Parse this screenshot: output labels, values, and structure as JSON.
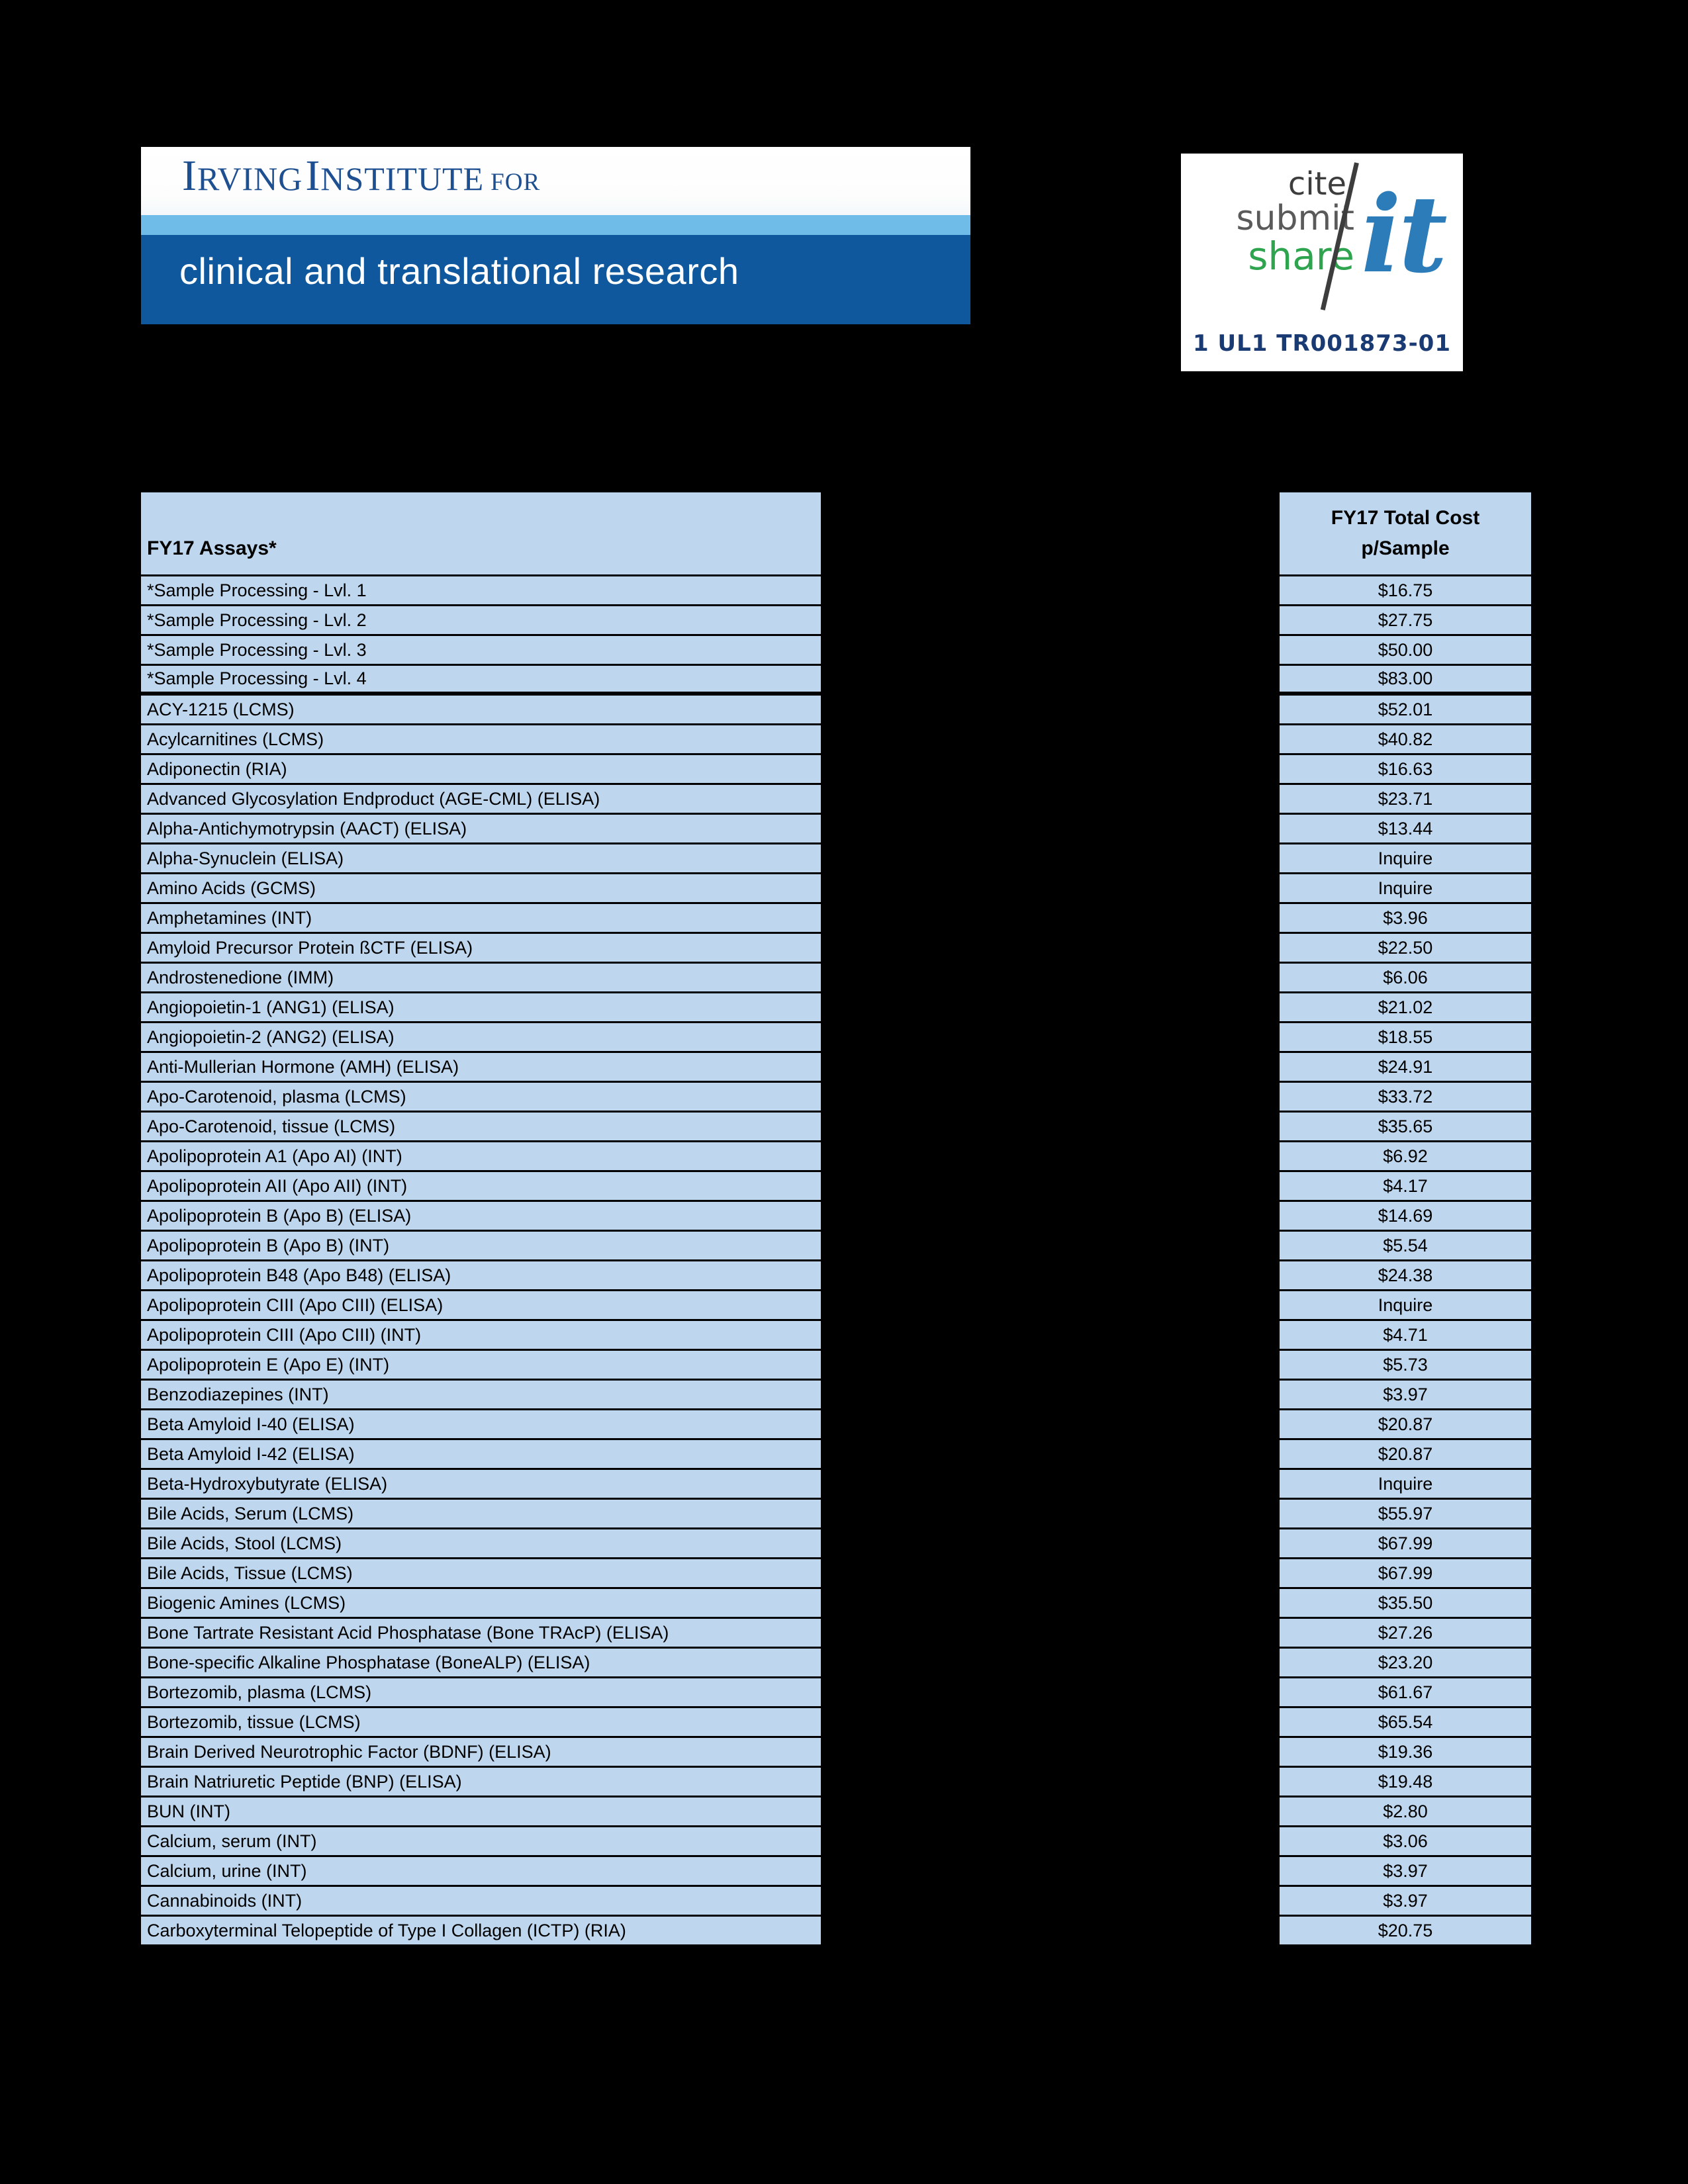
{
  "header": {
    "irving_logo": {
      "line1_word1": "I",
      "line1_word1_rest": "RVING",
      "line1_word2": "I",
      "line1_word2_rest": "NSTITUTE",
      "line1_for": "FOR",
      "line2": "clinical and translational research",
      "colors": {
        "title_blue": "#1d4f91",
        "band_light": "#6fbce8",
        "band_dark": "#10589e"
      }
    },
    "cite_logo": {
      "word_cite": "cite",
      "word_submit": "submit",
      "word_share": "share",
      "word_it": "it",
      "grant_number": "1 UL1 TR001873-01",
      "colors": {
        "cite": "#3d3d3d",
        "submit": "#5a5a5a",
        "share": "#2ea44f",
        "it": "#2b7cb8",
        "grant": "#1a3a73"
      }
    }
  },
  "table": {
    "columns": {
      "assay": "FY17 Assays*",
      "cost_line1": "FY17 Total Cost",
      "cost_line2": "p/Sample"
    },
    "colors": {
      "cell_fill": "#bed7ee",
      "grid": "#000000",
      "page_background": "#000000"
    },
    "rows": [
      {
        "assay": "*Sample Processing - Lvl. 1",
        "cost": "$16.75"
      },
      {
        "assay": "*Sample Processing - Lvl. 2",
        "cost": "$27.75"
      },
      {
        "assay": "*Sample Processing - Lvl. 3",
        "cost": "$50.00"
      },
      {
        "assay": "*Sample Processing - Lvl. 4",
        "cost": "$83.00"
      },
      {
        "assay": "ACY-1215 (LCMS)",
        "cost": "$52.01"
      },
      {
        "assay": "Acylcarnitines (LCMS)",
        "cost": "$40.82"
      },
      {
        "assay": "Adiponectin (RIA)",
        "cost": "$16.63"
      },
      {
        "assay": "Advanced Glycosylation Endproduct  (AGE-CML) (ELISA)",
        "cost": "$23.71"
      },
      {
        "assay": "Alpha-Antichymotrypsin (AACT) (ELISA)",
        "cost": "$13.44"
      },
      {
        "assay": "Alpha-Synuclein (ELISA)",
        "cost": "Inquire"
      },
      {
        "assay": "Amino Acids (GCMS)",
        "cost": "Inquire"
      },
      {
        "assay": "Amphetamines (INT)",
        "cost": "$3.96"
      },
      {
        "assay": "Amyloid Precursor Protein ßCTF (ELISA)",
        "cost": "$22.50"
      },
      {
        "assay": "Androstenedione (IMM)",
        "cost": "$6.06"
      },
      {
        "assay": "Angiopoietin-1 (ANG1) (ELISA)",
        "cost": "$21.02"
      },
      {
        "assay": "Angiopoietin-2 (ANG2)  (ELISA)",
        "cost": "$18.55"
      },
      {
        "assay": "Anti-Mullerian Hormone (AMH) (ELISA)",
        "cost": "$24.91"
      },
      {
        "assay": "Apo-Carotenoid, plasma (LCMS)",
        "cost": "$33.72"
      },
      {
        "assay": "Apo-Carotenoid, tissue (LCMS)",
        "cost": "$35.65"
      },
      {
        "assay": "Apolipoprotein A1 (Apo AI) (INT)",
        "cost": "$6.92"
      },
      {
        "assay": "Apolipoprotein AII (Apo AII) (INT)",
        "cost": "$4.17"
      },
      {
        "assay": "Apolipoprotein B (Apo B) (ELISA)",
        "cost": "$14.69"
      },
      {
        "assay": "Apolipoprotein B (Apo B) (INT)",
        "cost": "$5.54"
      },
      {
        "assay": "Apolipoprotein B48 (Apo B48) (ELISA)",
        "cost": "$24.38"
      },
      {
        "assay": "Apolipoprotein CIII (Apo CIII) (ELISA)",
        "cost": "Inquire"
      },
      {
        "assay": "Apolipoprotein CIII (Apo CIII) (INT)",
        "cost": "$4.71"
      },
      {
        "assay": "Apolipoprotein E (Apo E) (INT)",
        "cost": "$5.73"
      },
      {
        "assay": "Benzodiazepines (INT)",
        "cost": "$3.97"
      },
      {
        "assay": "Beta Amyloid I-40 (ELISA)",
        "cost": "$20.87"
      },
      {
        "assay": "Beta Amyloid I-42 (ELISA)",
        "cost": "$20.87"
      },
      {
        "assay": "Beta-Hydroxybutyrate  (ELISA)",
        "cost": "Inquire"
      },
      {
        "assay": "Bile Acids, Serum (LCMS)",
        "cost": "$55.97"
      },
      {
        "assay": "Bile Acids, Stool (LCMS)",
        "cost": "$67.99"
      },
      {
        "assay": "Bile Acids, Tissue (LCMS)",
        "cost": "$67.99"
      },
      {
        "assay": "Biogenic Amines (LCMS)",
        "cost": "$35.50"
      },
      {
        "assay": "Bone Tartrate Resistant Acid Phosphatase (Bone TRAcP) (ELISA)",
        "cost": "$27.26"
      },
      {
        "assay": "Bone-specific Alkaline Phosphatase (BoneALP) (ELISA)",
        "cost": "$23.20"
      },
      {
        "assay": "Bortezomib, plasma (LCMS)",
        "cost": "$61.67"
      },
      {
        "assay": "Bortezomib, tissue (LCMS)",
        "cost": "$65.54"
      },
      {
        "assay": "Brain Derived Neurotrophic Factor (BDNF) (ELISA)",
        "cost": "$19.36"
      },
      {
        "assay": "Brain Natriuretic Peptide (BNP) (ELISA)",
        "cost": "$19.48"
      },
      {
        "assay": "BUN (INT)",
        "cost": "$2.80"
      },
      {
        "assay": "Calcium, serum (INT)",
        "cost": "$3.06"
      },
      {
        "assay": "Calcium, urine (INT)",
        "cost": "$3.97"
      },
      {
        "assay": "Cannabinoids (INT)",
        "cost": "$3.97"
      },
      {
        "assay": "Carboxyterminal Telopeptide of Type I Collagen (ICTP) (RIA)",
        "cost": "$20.75"
      }
    ]
  }
}
